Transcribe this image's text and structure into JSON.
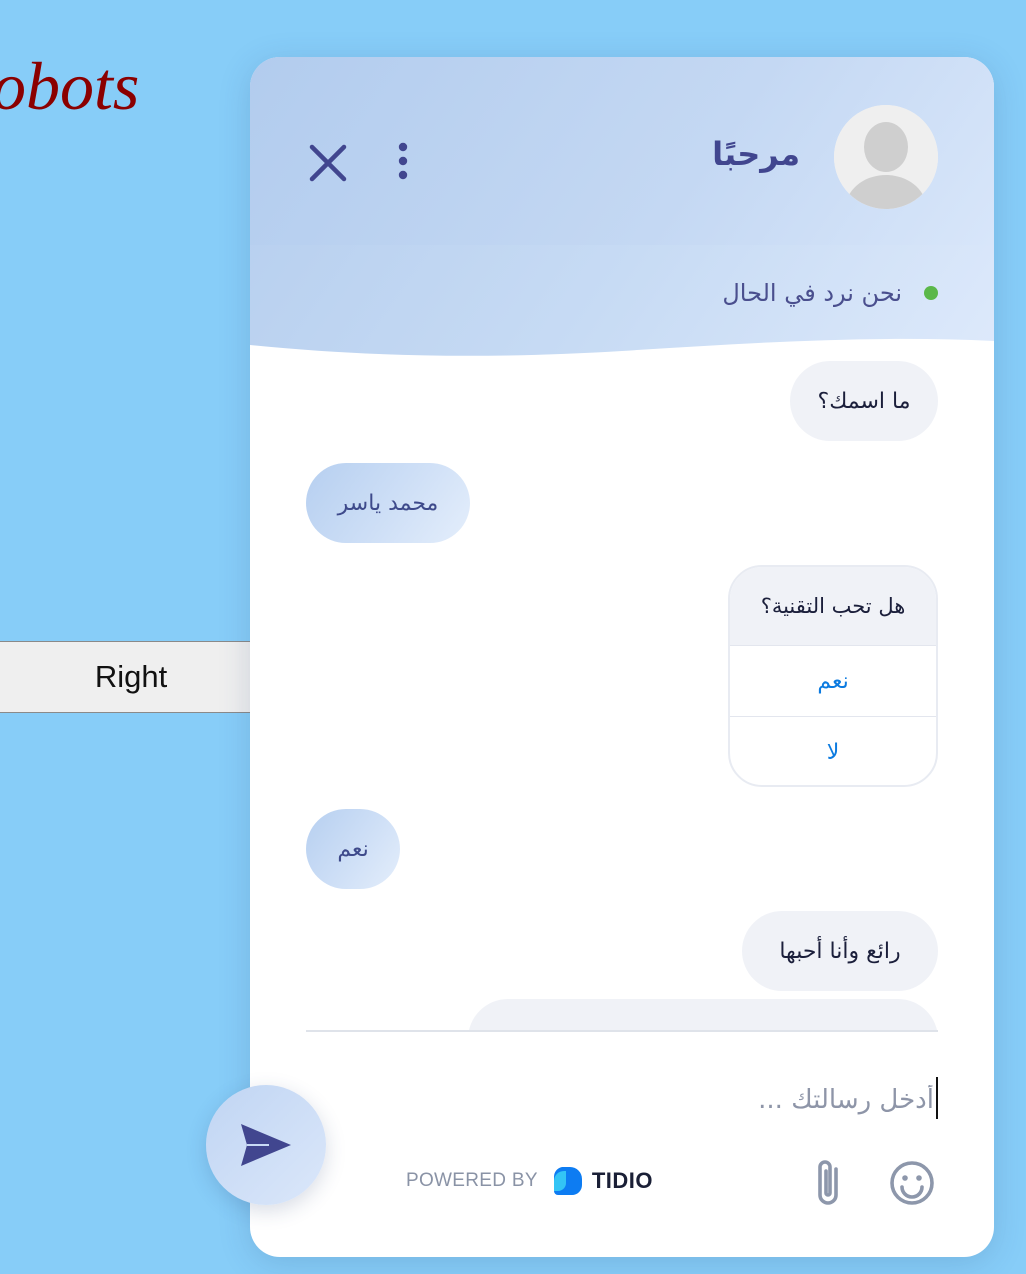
{
  "background": {
    "title_fragment": "obots",
    "side_button_label": "Right"
  },
  "chat": {
    "header": {
      "title": "مرحبًا",
      "status_text": "نحن نرد في الحال",
      "status_color": "#5bb84a",
      "avatar_icon": "default-user-avatar",
      "close_icon": "close-icon",
      "menu_icon": "kebab-menu-icon"
    },
    "messages": [
      {
        "from": "bot",
        "text": "ما اسمك؟"
      },
      {
        "from": "user",
        "text": "محمد ياسر"
      },
      {
        "from": "bot",
        "type": "quick_reply",
        "text": "هل تحب التقنية؟",
        "options": [
          "نعم",
          "لا"
        ]
      },
      {
        "from": "user",
        "text": "نعم"
      },
      {
        "from": "bot",
        "text": "رائع وأنا أحبها"
      }
    ],
    "input": {
      "placeholder": "أدخل رسالتك ...",
      "value": ""
    },
    "footer": {
      "powered_by": "POWERED BY",
      "brand": "TIDIO",
      "attach_icon": "paperclip-icon",
      "emoji_icon": "smiley-icon"
    },
    "send_icon": "send-icon",
    "colors": {
      "accent": "#41468f",
      "link": "#0c7be0",
      "page_bg": "#87cdf8"
    }
  }
}
